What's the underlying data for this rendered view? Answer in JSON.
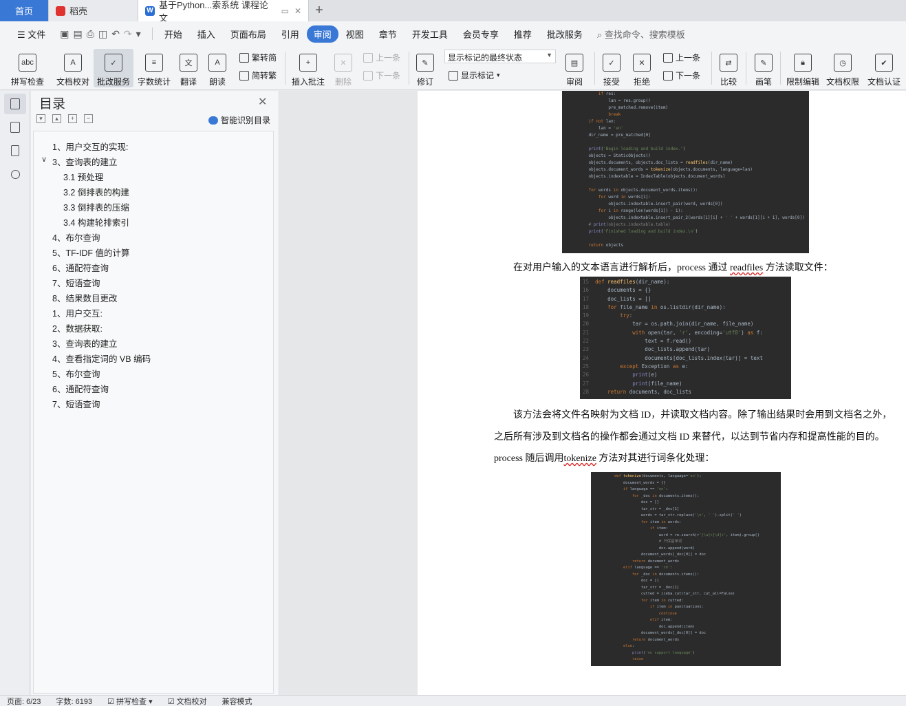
{
  "tabs": [
    {
      "label": "首页"
    },
    {
      "label": "稻壳"
    },
    {
      "label": "基于Python...索系统 课程论文"
    }
  ],
  "menu": {
    "file": "文件",
    "items": [
      "开始",
      "插入",
      "页面布局",
      "引用",
      "审阅",
      "视图",
      "章节",
      "开发工具",
      "会员专享",
      "推荐",
      "批改服务"
    ],
    "active": "审阅",
    "search": "查找命令、搜索模板"
  },
  "ribbon": {
    "spell": "拼写检查",
    "proof": "文档校对",
    "review_service": "批改服务",
    "wordcount": "字数统计",
    "translate": "翻译",
    "read": "朗读",
    "t2s": "繁转简",
    "s2t": "简转繁",
    "insert_comment": "插入批注",
    "delete": "删除",
    "prev": "上一条",
    "next": "下一条",
    "track": "修订",
    "show_state": "显示标记的最终状态",
    "show_marks": "显示标记",
    "review": "审阅",
    "accept": "接受",
    "reject": "拒绝",
    "prev2": "上一条",
    "next2": "下一条",
    "compare": "比较",
    "pen": "画笔",
    "restrict": "限制编辑",
    "doc_rights": "文档权限",
    "doc_cert": "文档认证"
  },
  "toc": {
    "title": "目录",
    "smart": "智能识别目录",
    "items": [
      "1、用户交互的实现:",
      "3、查询表的建立",
      "3.1 预处理",
      "3.2 倒排表的构建",
      "3.3 倒排表的压缩",
      "3.4 构建轮排索引",
      "4、布尔查询",
      "5、TF-IDF 值的计算",
      "6、通配符查询",
      "7、短语查询",
      "8、结果数目更改",
      "1、用户交互:",
      "2、数据获取:",
      "3、查询表的建立",
      "4、查看指定词的 VB 编码",
      "5、布尔查询",
      "6、通配符查询",
      "7、短语查询"
    ]
  },
  "document": {
    "para1_a": "在对用户输入的文本语言进行解析后，process 通过 ",
    "para1_b": "readfiles",
    "para1_c": " 方法读取文件：",
    "para2_line1": "该方法会将文件名映射为文档 ID，并读取文档内容。除了输出结果时会用到文档名之外，",
    "para2_line2": "之后所有涉及到文档名的操作都会通过文档 ID 来替代，以达到节省内存和提高性能的目的。",
    "para3_a": "process 随后调用",
    "para3_b": "tokenize",
    "para3_c": " 方法对其进行词条化处理：",
    "code1": [
      "        if res:",
      "            lan = res.group()",
      "            pre_matched.remove(item)",
      "            break",
      "    if not lan:",
      "        lan = 'en'",
      "    dir_name = pre_matched[0]",
      "",
      "    print('Begin loading and build index.')",
      "    objects = StaticObjects()",
      "    objects.documents, objects.doc_lists = readfiles(dir_name)",
      "    objects.document_words = tokenize(objects.documents, language=lan)",
      "    objects.indextable = IndexTable(objects.document_words)",
      "",
      "    for words in objects.document_words.items():",
      "        for word in words[1]:",
      "            objects.indextable.insert_pair(word, words[0])",
      "        for i in range(len(words[1]) - 1):",
      "            objects.indextable.insert_pair_2(words[1][i] + ' ' + words[1][i + 1], words[0])",
      "    # print(objects.indextable.table)",
      "    print('Finished loading and build index.\\n')",
      "",
      "    return objects"
    ],
    "code2": [
      "15  def readfiles(dir_name):",
      "16      documents = {}",
      "17      doc_lists = []",
      "18      for file_name in os.listdir(dir_name):",
      "19          try:",
      "20              tar = os.path.join(dir_name, file_name)",
      "21              with open(tar, 'r', encoding='utf8') as f:",
      "22                  text = f.read()",
      "23                  doc_lists.append(tar)",
      "24                  documents[doc_lists.index(tar)] = text",
      "25          except Exception as e:",
      "26              print(e)",
      "27              print(file_name)",
      "28      return documents, doc_lists"
    ],
    "code3": [
      "def tokenize(documents, language='en'):",
      "    document_words = {}",
      "    if language == 'en':",
      "        for _doc in documents.items():",
      "            doc = []",
      "            tar_str = _doc[1]",
      "            words = tar_str.replace('\\n', ' ').split(' ')",
      "            for item in words:",
      "                if item:",
      "                    word = re.search(r'[\\w]+[\\d]+', item).group()",
      "                    # 只保留单词",
      "                    doc.append(word)",
      "            document_words[_doc[0]] = doc",
      "        return document_words",
      "    elif language == 'zh':",
      "        for _doc in documents.items():",
      "            doc = []",
      "            tar_str = _doc[1]",
      "            cutted = jieba.cut(tar_str, cut_all=False)",
      "            for item in cutted:",
      "                if item in punctuations:",
      "                    continue",
      "                elif item:",
      "                    doc.append(item)",
      "            document_words[_doc[0]] = doc",
      "        return document_words",
      "    else:",
      "        print('no support language')",
      "        raise"
    ]
  },
  "status": {
    "page": "页面: 6/23",
    "words": "字数: 6193",
    "spell": "拼写检查",
    "proof": "文档校对",
    "compat": "兼容模式"
  }
}
